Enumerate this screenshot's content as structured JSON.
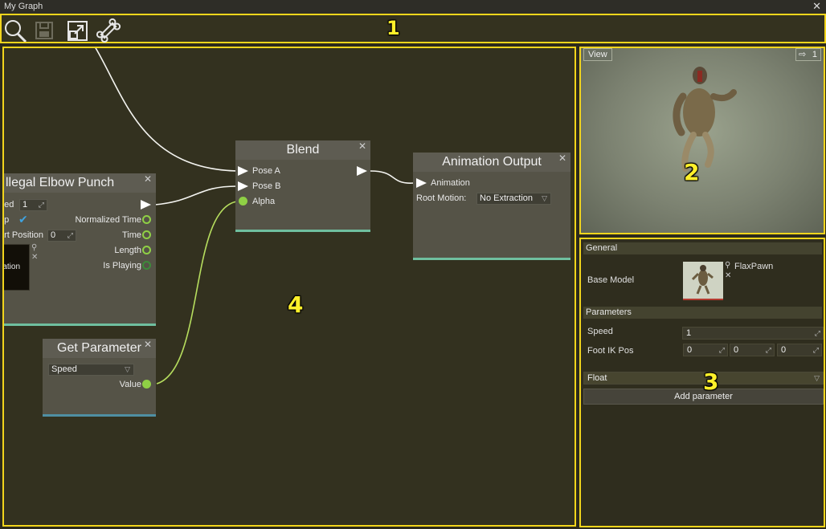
{
  "window": {
    "title": "My Graph",
    "close_glyph": "✕"
  },
  "toolbar": {
    "buttons": [
      {
        "icon": "search-icon"
      },
      {
        "icon": "save-icon"
      },
      {
        "icon": "import-icon"
      },
      {
        "icon": "bone-icon"
      }
    ]
  },
  "callouts": {
    "toolbar": "1",
    "preview": "2",
    "properties": "3",
    "graph": "4"
  },
  "graph": {
    "nodes": {
      "blend": {
        "title": "Blend",
        "inputs": [
          "Pose A",
          "Pose B",
          "Alpha"
        ]
      },
      "output": {
        "title": "Animation Output",
        "input": "Animation",
        "root_motion_label": "Root Motion:",
        "root_motion_value": "No Extraction"
      },
      "clip": {
        "title": "llegal Elbow Punch",
        "speed_label": "eed",
        "speed_value": "1",
        "loop_label": "op",
        "start_label": "art Position",
        "start_value": "0",
        "preview_text": "ration",
        "outputs": [
          "Normalized Time",
          "Time",
          "Length",
          "Is Playing"
        ]
      },
      "getparam": {
        "title": "Get Parameter",
        "param": "Speed",
        "output": "Value"
      }
    },
    "close_glyph": "✕"
  },
  "preview": {
    "view_label": "View",
    "speed_value": "1"
  },
  "properties": {
    "general_header": "General",
    "base_model_label": "Base Model",
    "base_model_value": "FlaxPawn",
    "parameters_header": "Parameters",
    "params": [
      {
        "label": "Speed",
        "values": [
          "1"
        ]
      },
      {
        "label": "Foot IK Pos",
        "values": [
          "0",
          "0",
          "0"
        ]
      }
    ],
    "type_select": "Float",
    "add_button": "Add parameter"
  },
  "colors": {
    "highlight": "#f2d51c",
    "accent": "#6fbf9f",
    "pin": "#8fd045"
  }
}
